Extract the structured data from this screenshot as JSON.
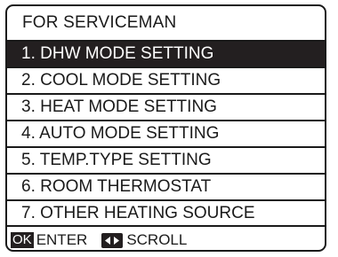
{
  "screen": {
    "title": "FOR SERVICEMAN"
  },
  "menu": {
    "items": [
      {
        "label": "1. DHW MODE SETTING",
        "selected": true
      },
      {
        "label": "2. COOL MODE SETTING",
        "selected": false
      },
      {
        "label": "3. HEAT MODE SETTING",
        "selected": false
      },
      {
        "label": "4. AUTO MODE SETTING",
        "selected": false
      },
      {
        "label": "5. TEMP.TYPE SETTING",
        "selected": false
      },
      {
        "label": "6. ROOM THERMOSTAT",
        "selected": false
      },
      {
        "label": "7. OTHER HEATING SOURCE",
        "selected": false
      }
    ]
  },
  "footer": {
    "ok_key": "OK",
    "enter_label": "ENTER",
    "scroll_key_icon": "left-right-arrows-icon",
    "scroll_label": "SCROLL"
  },
  "colors": {
    "foreground": "#1a1a1a",
    "highlight_background": "#231f20",
    "highlight_text": "#ffffff",
    "background": "#ffffff"
  }
}
